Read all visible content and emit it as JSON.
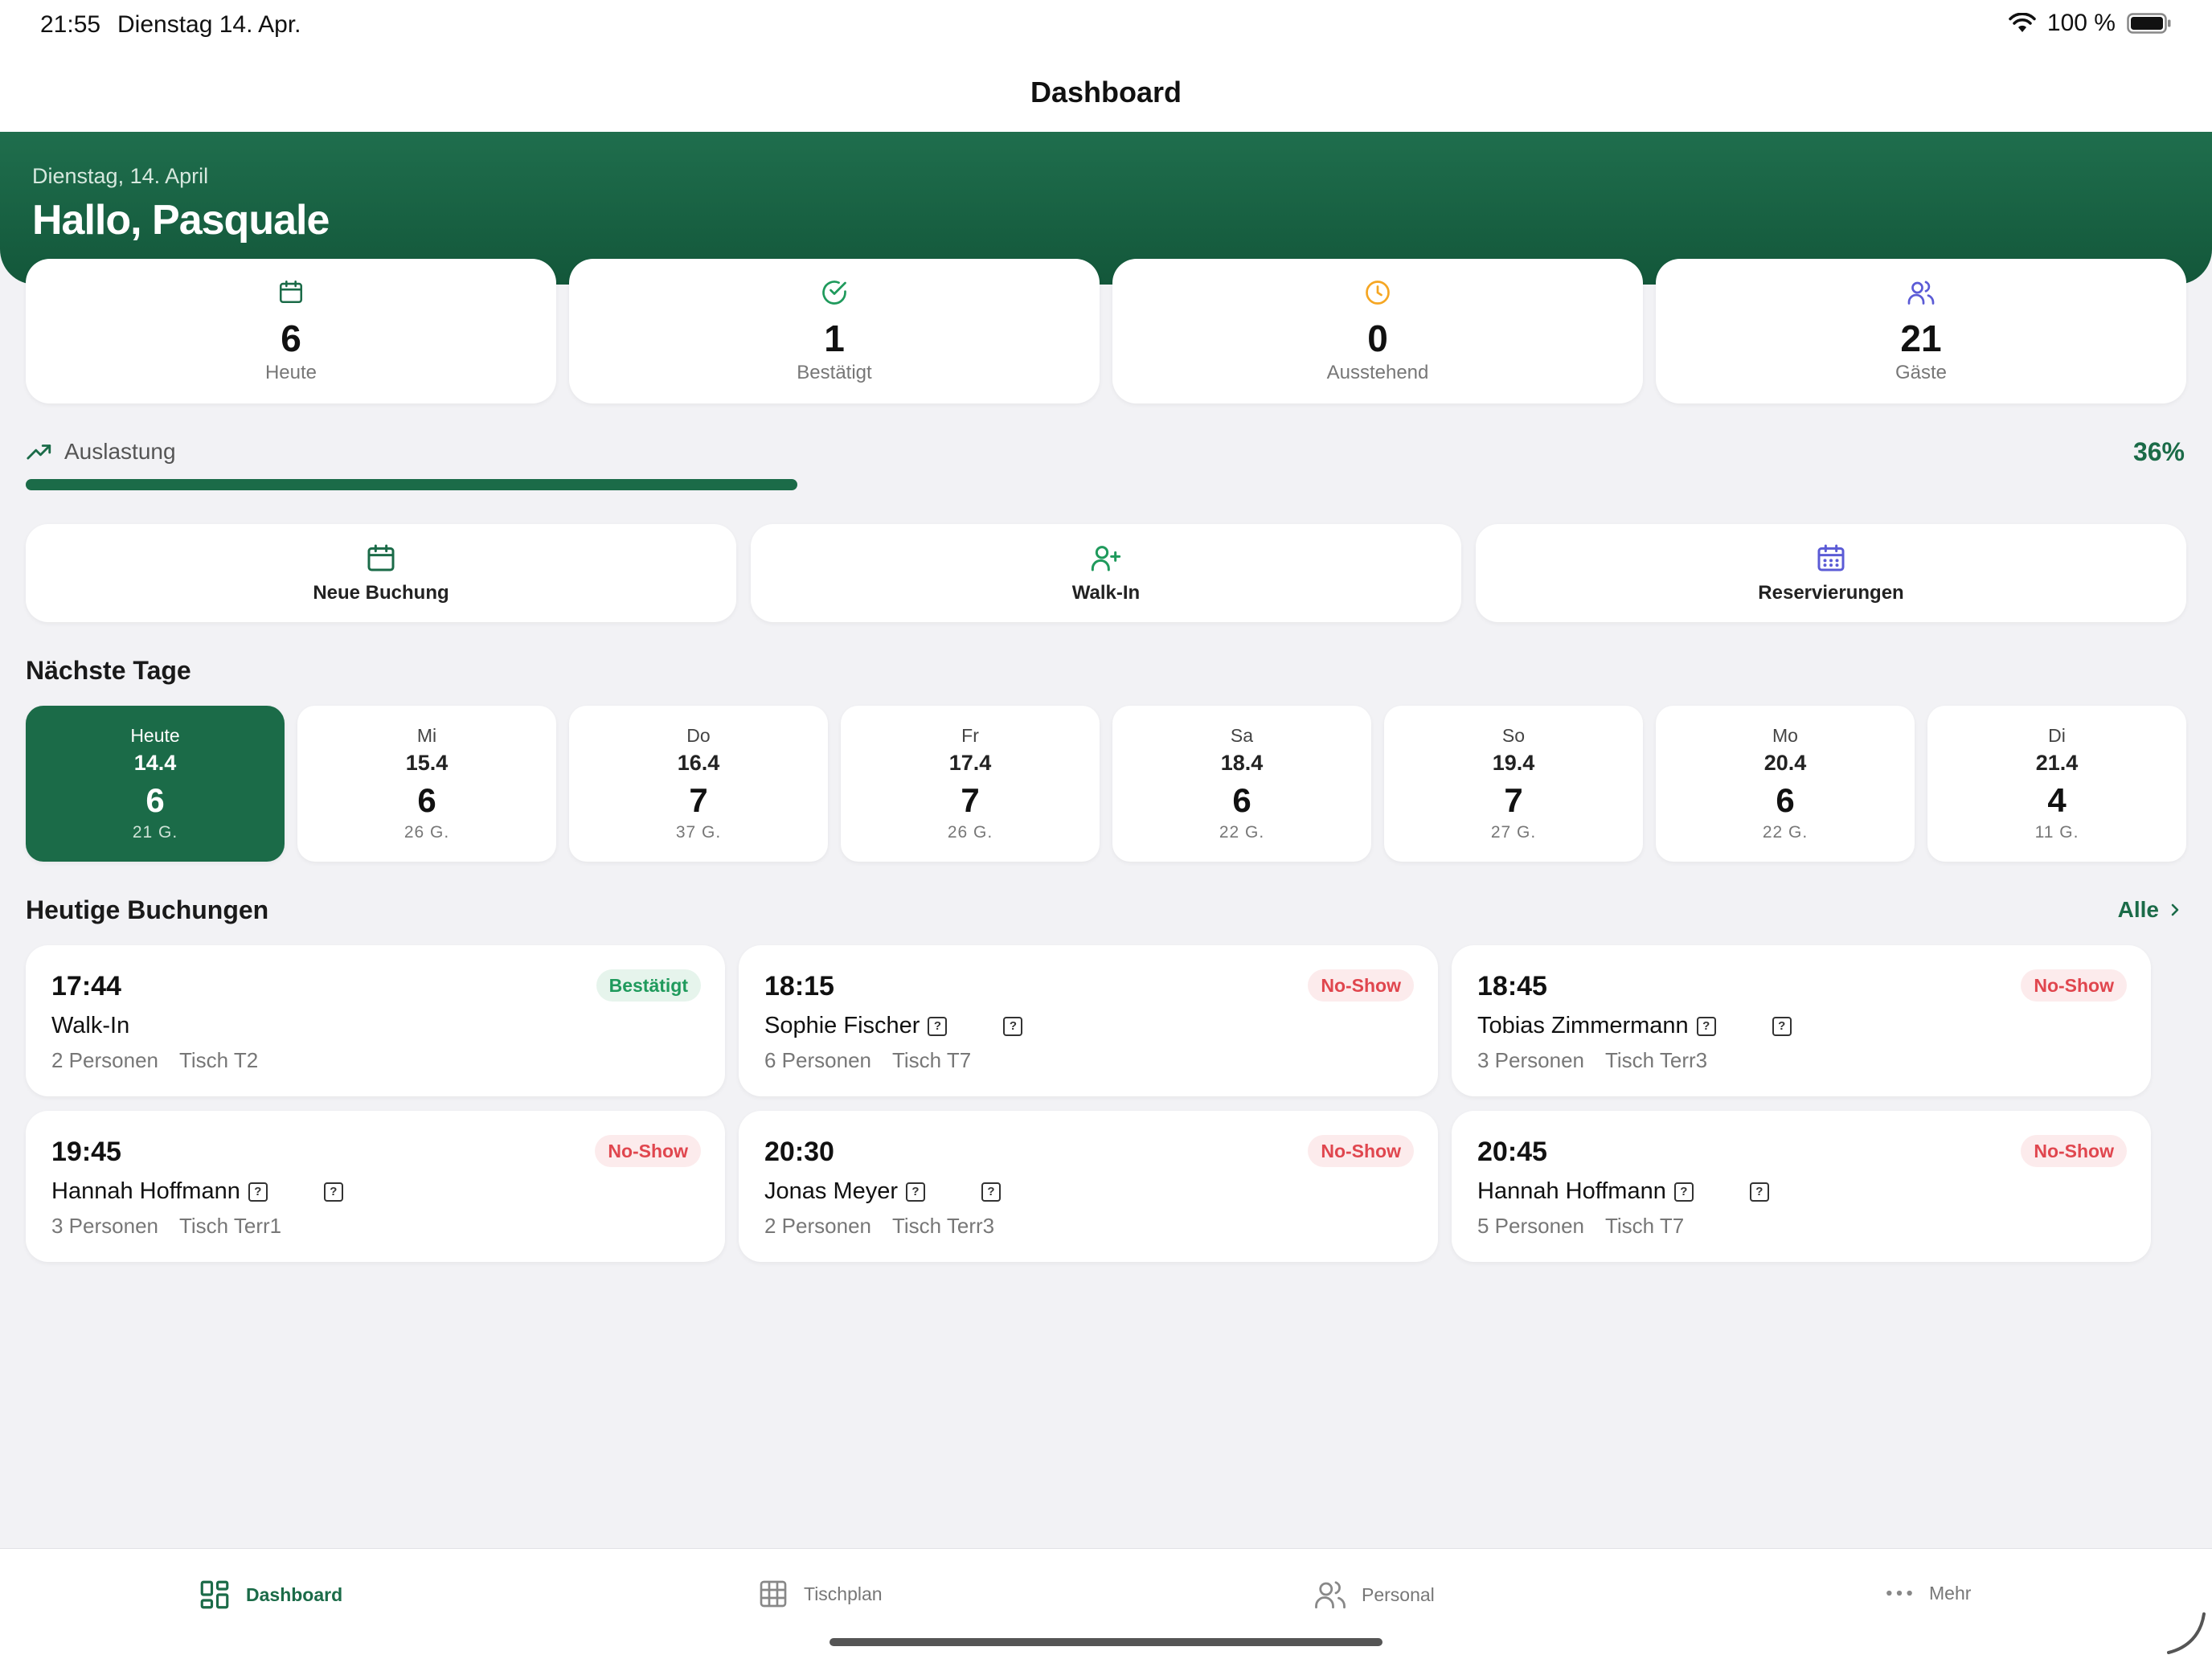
{
  "status": {
    "time": "21:55",
    "date": "Dienstag 14. Apr.",
    "battery": "100 %"
  },
  "nav": {
    "title": "Dashboard"
  },
  "hero": {
    "date": "Dienstag, 14. April",
    "greeting": "Hallo, Pasquale"
  },
  "stats": [
    {
      "value": "6",
      "label": "Heute",
      "icon": "calendar-icon",
      "color": "#1b6b48"
    },
    {
      "value": "1",
      "label": "Bestätigt",
      "icon": "check-circle-icon",
      "color": "#1f9a5c"
    },
    {
      "value": "0",
      "label": "Ausstehend",
      "icon": "clock-icon",
      "color": "#f5a623"
    },
    {
      "value": "21",
      "label": "Gäste",
      "icon": "users-icon",
      "color": "#5b5bd6"
    }
  ],
  "occupancy": {
    "label": "Auslastung",
    "value_text": "36%",
    "value": 0.36
  },
  "actions": [
    {
      "label": "Neue Buchung",
      "icon": "calendar-icon",
      "color": "#1b6b48"
    },
    {
      "label": "Walk-In",
      "icon": "user-plus-icon",
      "color": "#1f9a5c"
    },
    {
      "label": "Reservierungen",
      "icon": "calendar-grid-icon",
      "color": "#5b5bd6"
    }
  ],
  "days_section": {
    "title": "Nächste Tage"
  },
  "days": [
    {
      "name": "Heute",
      "date": "14.4",
      "count": "6",
      "guests": "21 G."
    },
    {
      "name": "Mi",
      "date": "15.4",
      "count": "6",
      "guests": "26 G."
    },
    {
      "name": "Do",
      "date": "16.4",
      "count": "7",
      "guests": "37 G."
    },
    {
      "name": "Fr",
      "date": "17.4",
      "count": "7",
      "guests": "26 G."
    },
    {
      "name": "Sa",
      "date": "18.4",
      "count": "6",
      "guests": "22 G."
    },
    {
      "name": "So",
      "date": "19.4",
      "count": "7",
      "guests": "27 G."
    },
    {
      "name": "Mo",
      "date": "20.4",
      "count": "6",
      "guests": "22 G."
    },
    {
      "name": "Di",
      "date": "21.4",
      "count": "4",
      "guests": "11 G."
    }
  ],
  "bookings_section": {
    "title": "Heutige Buchungen",
    "all_label": "Alle"
  },
  "bookings": [
    {
      "time": "17:44",
      "status": "Bestätigt",
      "name": "Walk-In",
      "persons": "2 Personen",
      "table": "Tisch T2",
      "has_marks": false
    },
    {
      "time": "18:15",
      "status": "No-Show",
      "name": "Sophie Fischer",
      "persons": "6 Personen",
      "table": "Tisch T7",
      "has_marks": true
    },
    {
      "time": "18:45",
      "status": "No-Show",
      "name": "Tobias Zimmermann",
      "persons": "3 Personen",
      "table": "Tisch Terr3",
      "has_marks": true
    },
    {
      "time": "19:45",
      "status": "No-Show",
      "name": "Hannah Hoffmann",
      "persons": "3 Personen",
      "table": "Tisch Terr1",
      "has_marks": true
    },
    {
      "time": "20:30",
      "status": "No-Show",
      "name": "Jonas Meyer",
      "persons": "2 Personen",
      "table": "Tisch Terr3",
      "has_marks": true
    },
    {
      "time": "20:45",
      "status": "No-Show",
      "name": "Hannah Hoffmann",
      "persons": "5 Personen",
      "table": "Tisch T7",
      "has_marks": true
    }
  ],
  "tabs": [
    {
      "label": "Dashboard",
      "icon": "dashboard-icon",
      "active": true
    },
    {
      "label": "Tischplan",
      "icon": "grid-icon",
      "active": false
    },
    {
      "label": "Personal",
      "icon": "users-icon",
      "active": false
    },
    {
      "label": "Mehr",
      "icon": "more-icon",
      "active": false
    }
  ],
  "colors": {
    "accent": "#1b6b48",
    "confirmed": "#1f9a5c",
    "noshow": "#e0464e",
    "pending": "#f5a623",
    "guests": "#5b5bd6"
  }
}
